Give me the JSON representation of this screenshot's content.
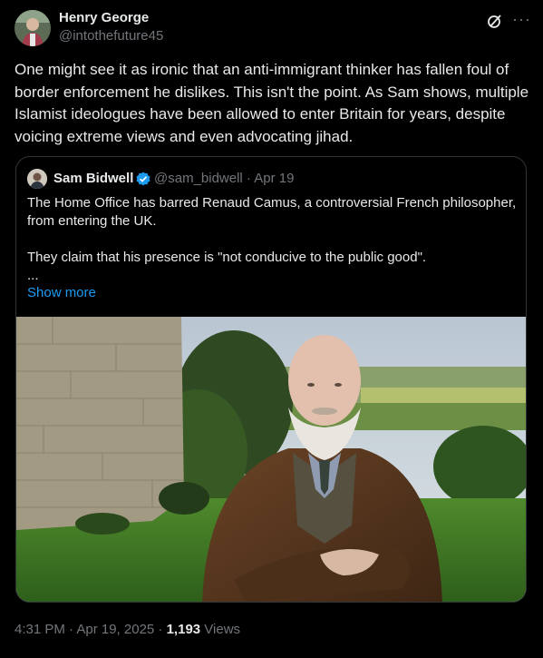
{
  "author": {
    "name": "Henry George",
    "handle": "@intothefuture45"
  },
  "icons": {
    "grok": "grok-icon",
    "more": "more-icon",
    "verified": "verified-badge-icon"
  },
  "post": {
    "text": "One might see it as ironic that an anti-immigrant thinker has fallen foul of border enforcement he dislikes. This isn't the point. As Sam shows, multiple Islamist ideologues have been allowed to enter Britain for years, despite voicing extreme views and even advocating jihad."
  },
  "quote": {
    "name": "Sam Bidwell",
    "handle_date": "@sam_bidwell · Apr 19",
    "text": "The Home Office has barred Renaud Camus, a controversial French philosopher, from entering the UK.\n\nThey claim that his presence is \"not conducive to the public good\".\n...",
    "show_more": "Show more"
  },
  "footer": {
    "time_date": "4:31 PM · Apr 19, 2025 · ",
    "views_count": "1,193",
    "views_label": " Views"
  },
  "colors": {
    "background": "#000000",
    "text": "#e7e9ea",
    "secondary": "#71767b",
    "link": "#1d9bf0",
    "border": "#2f3336"
  }
}
